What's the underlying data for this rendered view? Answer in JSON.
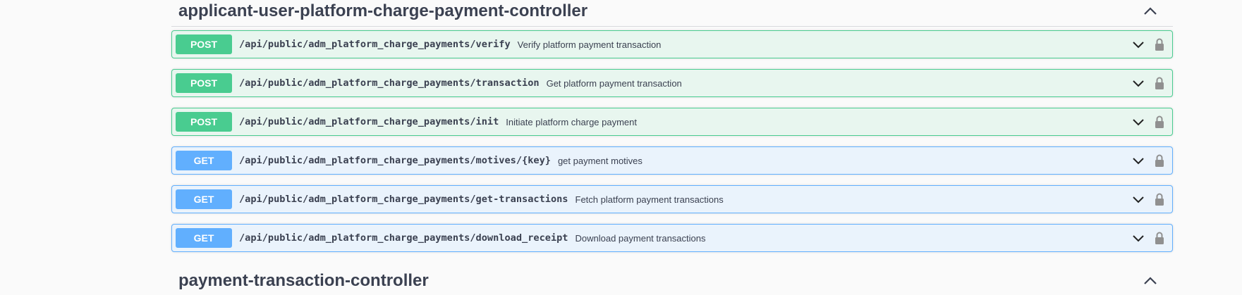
{
  "sections": [
    {
      "title": "applicant-user-platform-charge-payment-controller",
      "expanded": true
    },
    {
      "title": "payment-transaction-controller",
      "expanded": true
    }
  ],
  "operations": [
    {
      "method": "POST",
      "path": "/api/public/adm_platform_charge_payments/verify",
      "summary": "Verify platform payment transaction"
    },
    {
      "method": "POST",
      "path": "/api/public/adm_platform_charge_payments/transaction",
      "summary": "Get platform payment transaction"
    },
    {
      "method": "POST",
      "path": "/api/public/adm_platform_charge_payments/init",
      "summary": "Initiate platform charge payment"
    },
    {
      "method": "GET",
      "path": "/api/public/adm_platform_charge_payments/motives/{key}",
      "summary": "get payment motives"
    },
    {
      "method": "GET",
      "path": "/api/public/adm_platform_charge_payments/get-transactions",
      "summary": "Fetch platform payment transactions"
    },
    {
      "method": "GET",
      "path": "/api/public/adm_platform_charge_payments/download_receipt",
      "summary": "Download payment transactions"
    }
  ],
  "colors": {
    "post": "#49cc90",
    "post_bg": "#e8f6ef",
    "get": "#61affe",
    "get_bg": "#eaf3fc",
    "text": "#3b4151",
    "lock": "#909090"
  },
  "icons": {
    "expand": "chevron-down-icon",
    "collapse": "chevron-up-icon",
    "auth": "lock-icon"
  }
}
